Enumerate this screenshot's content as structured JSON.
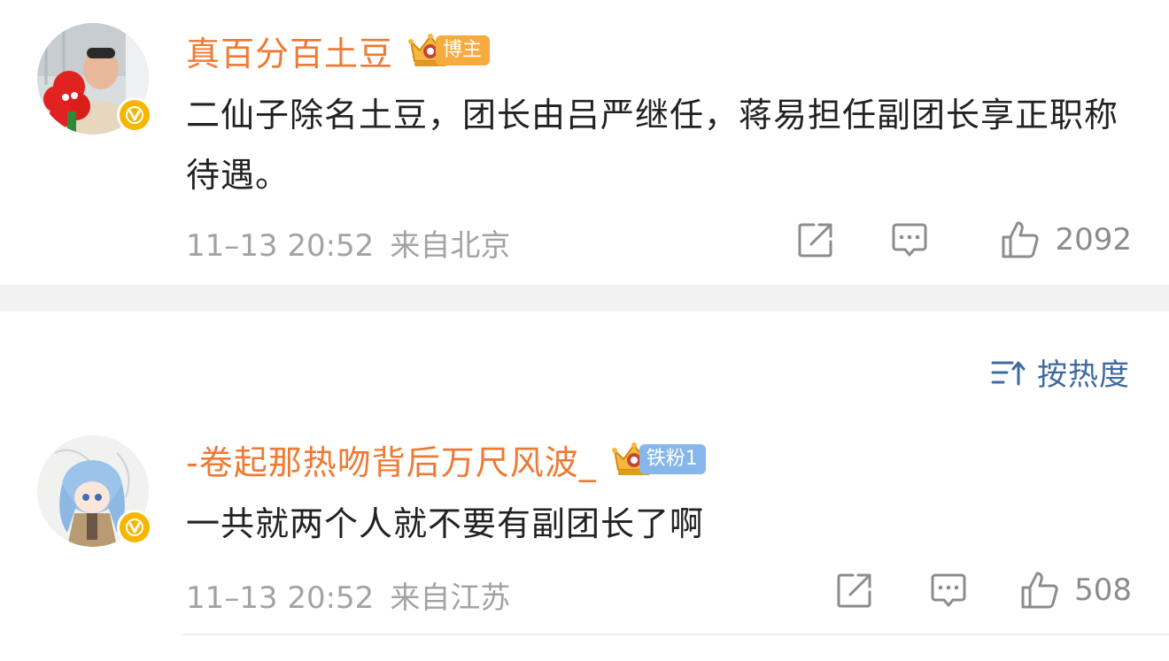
{
  "comments": [
    {
      "username": "真百分百土豆",
      "badge": "博主",
      "text": "二仙子除名土豆，团长由吕严继任，蒋易担任副团长享正职称待遇。",
      "time": "11–13 20:52",
      "location": "来自北京",
      "likes": "2092",
      "avatar_icon": "avatar-photo-man-with-red-plush",
      "verified_icon": "v-icon"
    },
    {
      "username": "-卷起那热吻背后万尺风波_",
      "badge": "铁粉1",
      "text": "一共就两个人就不要有副团长了啊",
      "time": "11–13 20:52",
      "location": "来自江苏",
      "likes": "508",
      "avatar_icon": "avatar-anime-blue-hair",
      "verified_icon": "v-icon"
    }
  ],
  "sort": {
    "label": "按热度",
    "icon": "sort-icon"
  },
  "colors": {
    "username": "#ee7a33",
    "text": "#222222",
    "meta": "#a3a3a3",
    "sort": "#3e6aa0",
    "divider": "#f2f2f2",
    "badge_blogger": "#f7ab3f",
    "badge_fan": "#86b6ea",
    "verified": "#f7b500"
  }
}
